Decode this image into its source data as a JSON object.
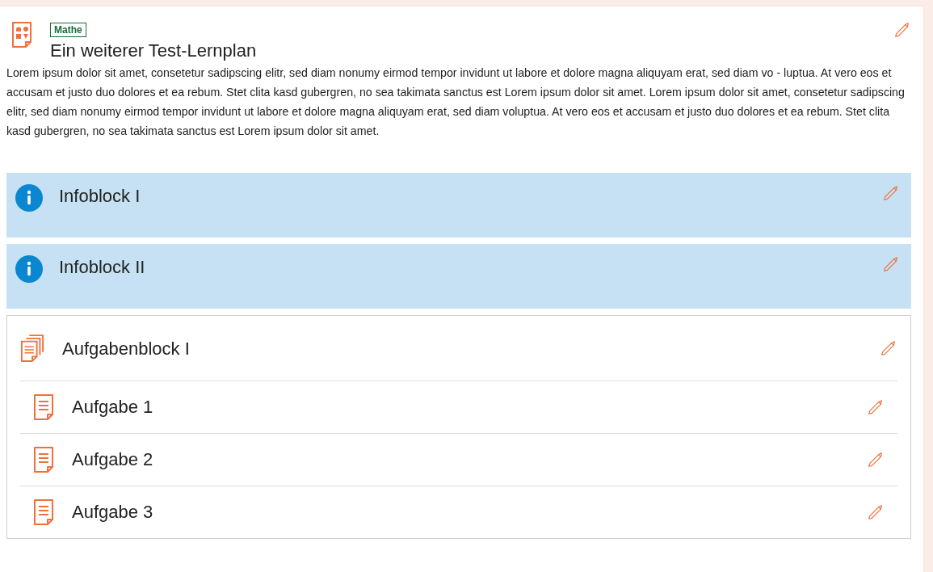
{
  "plan": {
    "subject": "Mathe",
    "title": "Ein weiterer Test-Lernplan",
    "description": "Lorem ipsum dolor sit amet, consetetur sadipscing elitr, sed diam nonumy eirmod tempor invidunt ut labore et dolore magna aliquyam erat, sed diam vo - luptua. At vero eos et accusam et justo duo dolores et ea rebum. Stet clita kasd gubergren, no sea takimata sanctus est Lorem ipsum dolor sit amet. Lorem ipsum dolor sit amet, consetetur sadipscing elitr, sed diam nonumy eirmod tempor invidunt ut labore et dolore magna aliquyam erat, sed diam voluptua. At vero eos et accusam et justo duo dolores et ea rebum. Stet clita kasd gubergren, no sea takimata sanctus est Lorem ipsum dolor sit amet."
  },
  "blocks": [
    {
      "kind": "info",
      "title": "Infoblock I"
    },
    {
      "kind": "info",
      "title": "Infoblock II"
    },
    {
      "kind": "tasks",
      "title": "Aufgabenblock I",
      "children": [
        {
          "title": "Aufgabe 1"
        },
        {
          "title": "Aufgabe 2"
        },
        {
          "title": "Aufgabe 3"
        }
      ]
    }
  ]
}
